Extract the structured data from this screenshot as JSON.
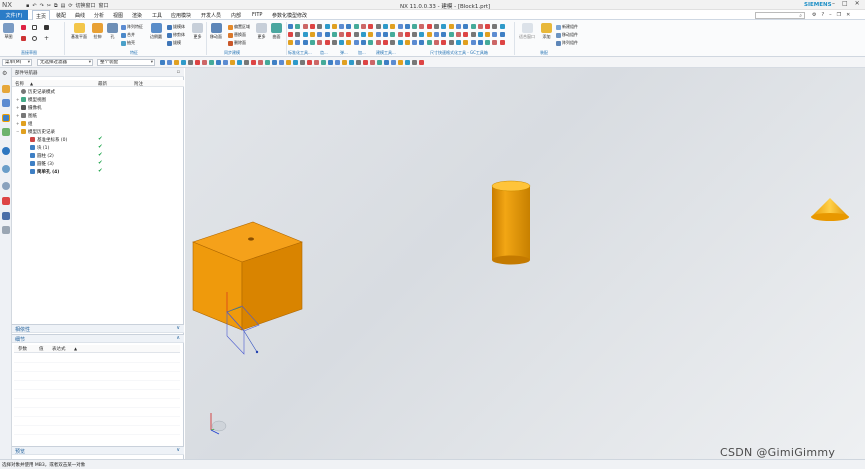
{
  "titlebar": {
    "app": "NX",
    "quick_switch": "切换窗口",
    "window_menu": "窗口",
    "title": "NX 11.0.0.33 - 建模 - [Block1.prt]",
    "brand": "SIEMENS"
  },
  "menu": {
    "file": "文件(F)",
    "tabs": [
      "主页",
      "装配",
      "曲线",
      "分析",
      "视图",
      "渲染",
      "工具",
      "应用模块",
      "开发人员",
      "内部",
      "FITP",
      "参数化模型修改"
    ],
    "search_placeholder": "查找命令"
  },
  "ribbon": {
    "sketch": "草图",
    "datum_plane": "基准平面",
    "extrude": "拉伸",
    "hole": "孔",
    "pattern_feature": "阵列特征",
    "unite": "合并",
    "shell": "抽壳",
    "edge_blend": "边倒圆",
    "more1": "拔模体",
    "more2": "修剪体",
    "more3": "拔模",
    "more_btn": "更多",
    "move_face": "移动面",
    "offset_region": "偏置区域",
    "replace_face": "替换面",
    "delete_face": "删除面",
    "more_btn2": "更多",
    "surface": "曲面",
    "fit_all": "适合窗口",
    "add": "添加",
    "new_component": "新建组件",
    "move_component": "移动组件",
    "pattern_component": "阵列组件",
    "groups": {
      "direct_sketch": "直接草图",
      "feature": "特征",
      "sync_modeling": "同步建模",
      "standard_tools": "标准化工具...",
      "gear": "齿...",
      "spring": "弹...",
      "machining": "加...",
      "modeling_tools": "建模工具...",
      "dimension_quick": "尺寸快速格式化工具 - GC工具箱",
      "assembly": "装配"
    }
  },
  "selbar": {
    "menu": "菜单(M)",
    "filter": "无选择过滤器",
    "scope": "整个装配"
  },
  "navigator": {
    "title": "部件导航器",
    "columns": {
      "name": "名称",
      "latest": "最新",
      "comment": "附注"
    },
    "rows": [
      {
        "label": "历史记录模式",
        "check": ""
      },
      {
        "label": "模型视图",
        "check": ""
      },
      {
        "label": "摄像机",
        "check": ""
      },
      {
        "label": "图纸",
        "check": ""
      },
      {
        "label": "组",
        "check": ""
      },
      {
        "label": "模型历史记录",
        "check": ""
      },
      {
        "label": "基准坐标系 (0)",
        "check": "✔"
      },
      {
        "label": "块 (1)",
        "check": "✔"
      },
      {
        "label": "圆柱 (2)",
        "check": "✔"
      },
      {
        "label": "圆锥 (3)",
        "check": "✔"
      },
      {
        "label": "简单孔 (4)",
        "check": "✔"
      }
    ],
    "panels": {
      "dependencies": "相依性",
      "details": "细节",
      "preview": "预览"
    },
    "detail_cols": {
      "param": "参数",
      "value": "值",
      "expr": "表达式"
    }
  },
  "status": "选择对象并使用 MB3，或者双击某一对象",
  "watermark": "CSDN @GimiGimmy",
  "colors": {
    "accent": "#2a7cc7",
    "solid": "#f0a000",
    "check": "#1da34a"
  }
}
